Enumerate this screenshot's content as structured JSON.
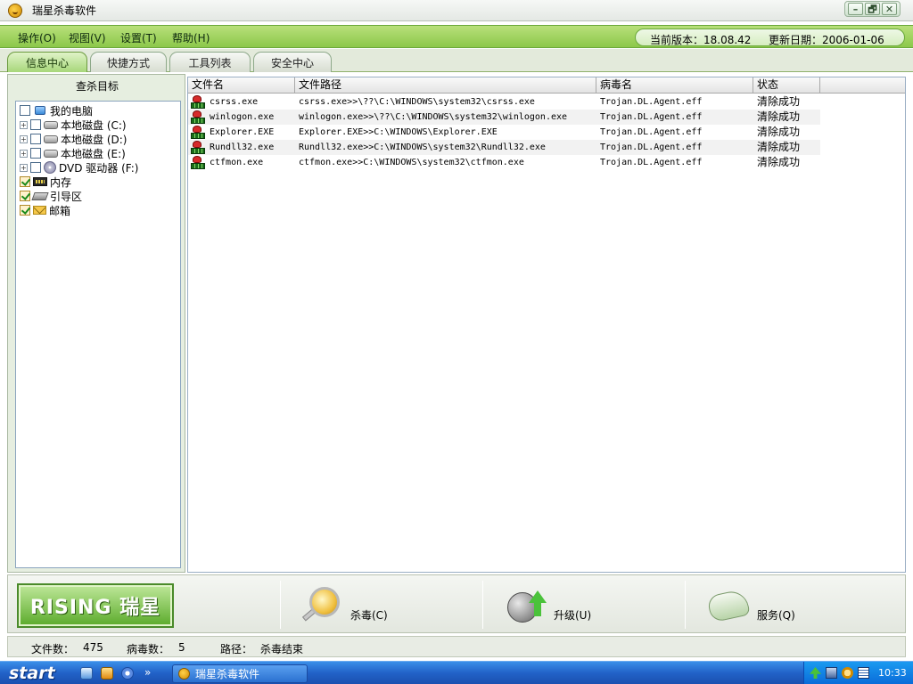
{
  "window": {
    "title": "瑞星杀毒软件",
    "controls": {
      "minimize": "–",
      "restore": "🗗",
      "close": "✕"
    }
  },
  "menu": {
    "items": [
      "操作(O)",
      "视图(V)",
      "设置(T)",
      "帮助(H)"
    ],
    "version_label": "当前版本：18.08.42",
    "update_label": "更新日期：2006-01-06"
  },
  "tabs": [
    {
      "label": "信息中心",
      "active": true
    },
    {
      "label": "快捷方式",
      "active": false
    },
    {
      "label": "工具列表",
      "active": false
    },
    {
      "label": "安全中心",
      "active": false
    }
  ],
  "left": {
    "title": "查杀目标",
    "tree": [
      {
        "label": "我的电脑",
        "icon": "computer-icon",
        "checked": false,
        "expander": false
      },
      {
        "label": "本地磁盘 (C:)",
        "icon": "drive-icon",
        "checked": false,
        "expander": true
      },
      {
        "label": "本地磁盘 (D:)",
        "icon": "drive-icon",
        "checked": false,
        "expander": true
      },
      {
        "label": "本地磁盘 (E:)",
        "icon": "drive-icon",
        "checked": false,
        "expander": true
      },
      {
        "label": "DVD 驱动器 (F:)",
        "icon": "dvd-icon",
        "checked": false,
        "expander": true
      },
      {
        "label": "内存",
        "icon": "memory-icon",
        "checked": true,
        "expander": false
      },
      {
        "label": "引导区",
        "icon": "boot-sector-icon",
        "checked": true,
        "expander": false
      },
      {
        "label": "邮箱",
        "icon": "mailbox-icon",
        "checked": true,
        "expander": false
      }
    ]
  },
  "table": {
    "headers": [
      "文件名",
      "文件路径",
      "病毒名",
      "状态"
    ],
    "rows": [
      {
        "file": "csrss.exe",
        "path": "csrss.exe>>\\??\\C:\\WINDOWS\\system32\\csrss.exe",
        "virus": "Trojan.DL.Agent.eff",
        "status": "清除成功"
      },
      {
        "file": "winlogon.exe",
        "path": "winlogon.exe>>\\??\\C:\\WINDOWS\\system32\\winlogon.exe",
        "virus": "Trojan.DL.Agent.eff",
        "status": "清除成功"
      },
      {
        "file": "Explorer.EXE",
        "path": "Explorer.EXE>>C:\\WINDOWS\\Explorer.EXE",
        "virus": "Trojan.DL.Agent.eff",
        "status": "清除成功"
      },
      {
        "file": "Rundll32.exe",
        "path": "Rundll32.exe>>C:\\WINDOWS\\system32\\Rundll32.exe",
        "virus": "Trojan.DL.Agent.eff",
        "status": "清除成功"
      },
      {
        "file": "ctfmon.exe",
        "path": "ctfmon.exe>>C:\\WINDOWS\\system32\\ctfmon.exe",
        "virus": "Trojan.DL.Agent.eff",
        "status": "清除成功"
      }
    ]
  },
  "actions": {
    "logo": "RISING 瑞星",
    "scan": "杀毒(C)",
    "upgrade": "升级(U)",
    "service": "服务(Q)"
  },
  "status": {
    "files_label": "文件数：",
    "files_value": "475",
    "virus_label": "病毒数：",
    "virus_value": "5",
    "path_label": "路径：",
    "path_value": "杀毒结束"
  },
  "taskbar": {
    "start": "start",
    "chevron": "»",
    "task": "瑞星杀毒软件",
    "clock": "10:33"
  },
  "colors": {
    "menu_green": "#8cc84a",
    "tab_active": "#a7d77a",
    "taskbar_blue": "#2262c8"
  }
}
